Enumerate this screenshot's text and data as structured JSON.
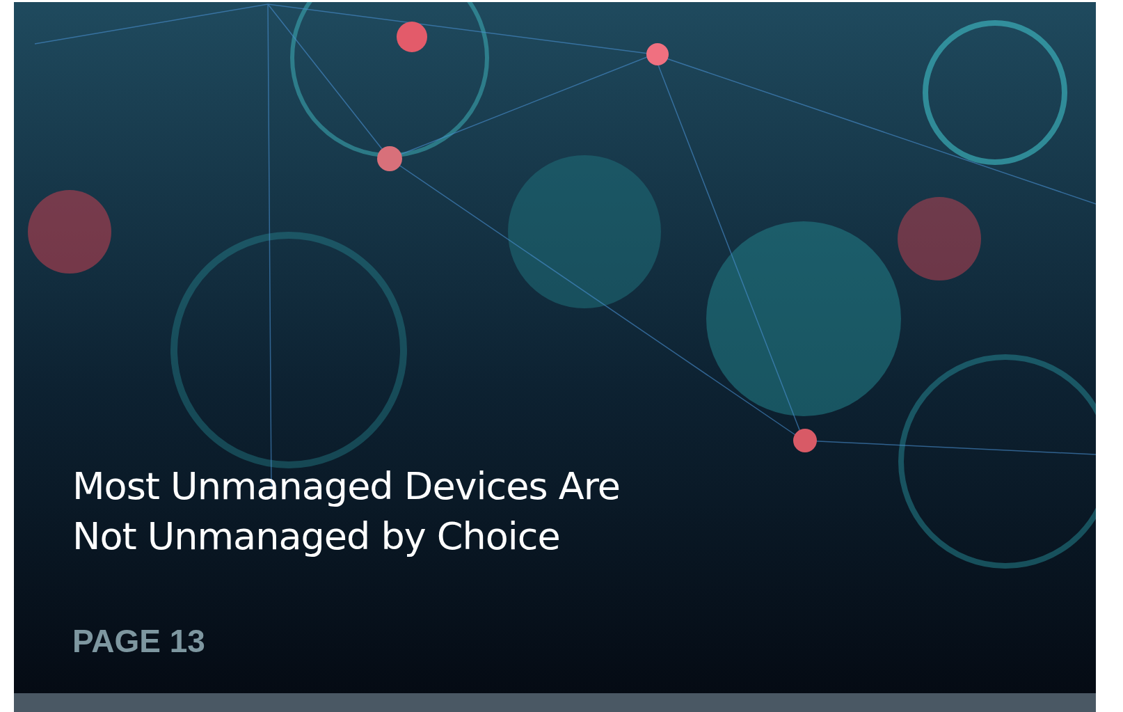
{
  "hero": {
    "kind": "picture",
    "title": "Most Unmanaged Devices Are Not Unmanaged by Choice",
    "page_label": "PAGE 13"
  }
}
